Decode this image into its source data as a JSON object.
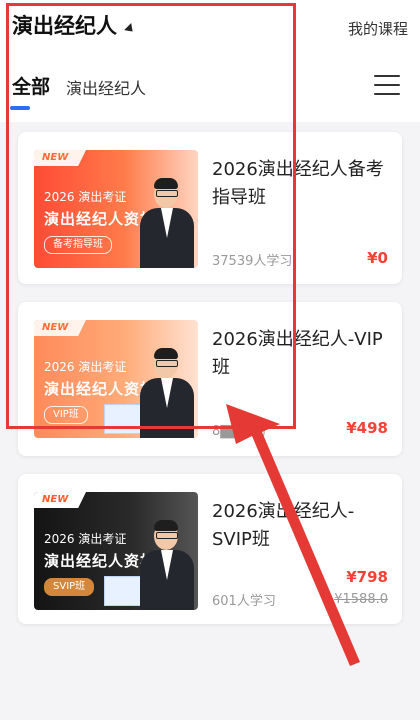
{
  "header": {
    "title": "演出经纪人",
    "my_courses": "我的课程"
  },
  "tabs": [
    {
      "label": "全部",
      "active": true
    },
    {
      "label": "演出经纪人",
      "active": false
    }
  ],
  "courses": [
    {
      "title": "2026演出经纪人备考指导班",
      "learners": "37539人学习",
      "price": "¥0",
      "thumb": {
        "tag": "NEW",
        "subtitle": "2026 演出考证",
        "main": "演出经纪人资格",
        "pill": "备考指导班"
      }
    },
    {
      "title": "2026演出经纪人-VIP班",
      "learners": "8▇▇学习",
      "price": "¥498",
      "thumb": {
        "tag": "NEW",
        "subtitle": "2026 演出考证",
        "main": "演出经纪人资格",
        "pill": "VIP班"
      }
    },
    {
      "title": "2026演出经纪人-SVIP班",
      "learners": "601人学习",
      "price": "¥798",
      "original_price": "¥1588.0",
      "thumb": {
        "tag": "NEW",
        "subtitle": "2026 演出考证",
        "main": "演出经纪人资格",
        "pill": "SVIP班"
      }
    }
  ],
  "colors": {
    "accent_blue": "#2f6cf6",
    "price_red": "#f44336",
    "annotation_red": "#e53935"
  },
  "icons": {
    "menu": "hamburger-menu-icon",
    "title_caret": "caret-down-icon"
  }
}
